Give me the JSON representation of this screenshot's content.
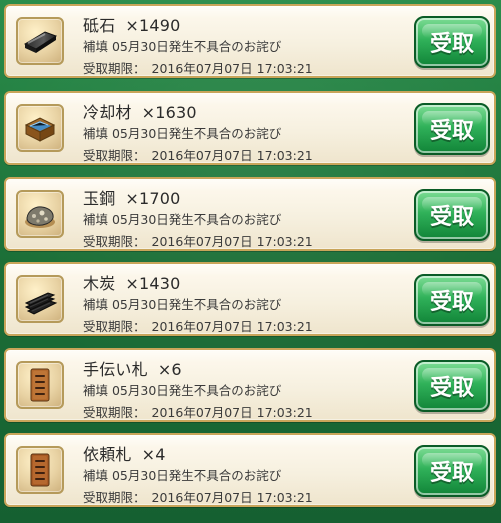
{
  "items": [
    {
      "name": "砥石",
      "qty": "×1490",
      "description": "補填 05月30日発生不具合のお詫び",
      "expiry_label": "受取期限：",
      "expiry_value": "2016年07月07日 17:03:21",
      "button_label": "受取",
      "icon": "whetstone-icon"
    },
    {
      "name": "冷却材",
      "qty": "×1630",
      "description": "補填 05月30日発生不具合のお詫び",
      "expiry_label": "受取期限：",
      "expiry_value": "2016年07月07日 17:03:21",
      "button_label": "受取",
      "icon": "coolant-box-icon"
    },
    {
      "name": "玉鋼",
      "qty": "×1700",
      "description": "補填 05月30日発生不具合のお詫び",
      "expiry_label": "受取期限：",
      "expiry_value": "2016年07月07日 17:03:21",
      "button_label": "受取",
      "icon": "tamahagane-icon"
    },
    {
      "name": "木炭",
      "qty": "×1430",
      "description": "補填 05月30日発生不具合のお詫び",
      "expiry_label": "受取期限：",
      "expiry_value": "2016年07月07日 17:03:21",
      "button_label": "受取",
      "icon": "charcoal-icon"
    },
    {
      "name": "手伝い札",
      "qty": "×6",
      "description": "補填 05月30日発生不具合のお詫び",
      "expiry_label": "受取期限：",
      "expiry_value": "2016年07月07日 17:03:21",
      "button_label": "受取",
      "icon": "helper-tag-icon"
    },
    {
      "name": "依頼札",
      "qty": "×4",
      "description": "補填 05月30日発生不具合のお詫び",
      "expiry_label": "受取期限：",
      "expiry_value": "2016年07月07日 17:03:21",
      "button_label": "受取",
      "icon": "request-tag-icon"
    }
  ],
  "colors": {
    "button_green": "#1da84a",
    "button_border": "#0a5b26",
    "card_border": "#c9a55a",
    "background_green": "#1f7a3c"
  }
}
